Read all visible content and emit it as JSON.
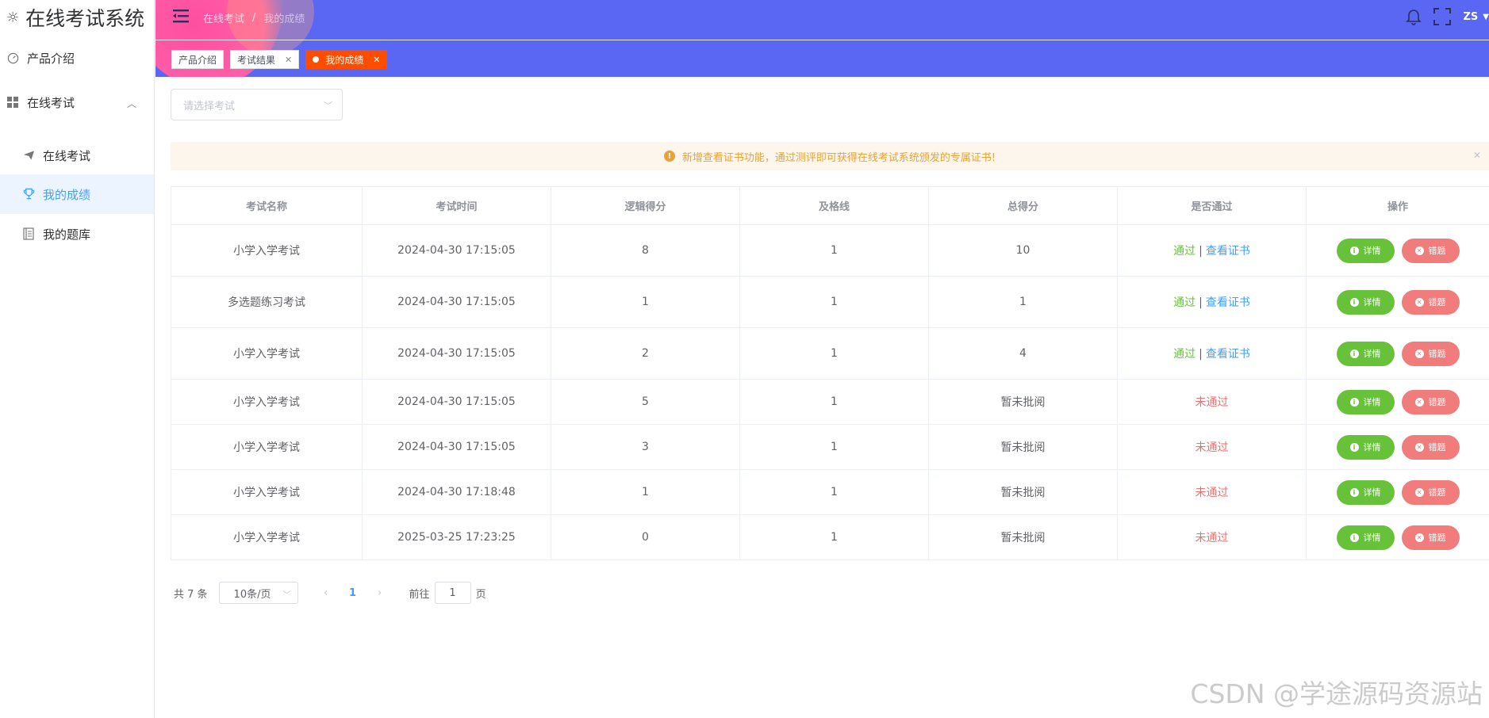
{
  "app": {
    "title": "在线考试系统",
    "logo_icon": "sun-icon"
  },
  "sidebar": {
    "items": [
      {
        "label": "产品介绍",
        "icon": "speedometer-icon"
      },
      {
        "label": "在线考试",
        "icon": "grid-icon",
        "expanded": true
      },
      {
        "label": "在线考试",
        "icon": "paper-plane-icon",
        "sub": true
      },
      {
        "label": "我的成绩",
        "icon": "trophy-icon",
        "sub": true,
        "active": true
      },
      {
        "label": "我的题库",
        "icon": "notebook-icon",
        "sub": true
      }
    ]
  },
  "header": {
    "breadcrumb": [
      "在线考试",
      "我的成绩"
    ],
    "breadcrumb_sep": "/",
    "user": "ZS",
    "icons": [
      "menu-fold-icon",
      "bell-icon",
      "fullscreen-icon"
    ]
  },
  "tags": [
    {
      "label": "产品介绍",
      "closable": false
    },
    {
      "label": "考试结果",
      "closable": true
    },
    {
      "label": "我的成绩",
      "closable": true,
      "active": true
    }
  ],
  "filter": {
    "placeholder": "请选择考试"
  },
  "alert": {
    "text": "新增查看证书功能，通过测评即可获得在线考试系统颁发的专属证书!"
  },
  "table": {
    "headers": [
      "考试名称",
      "考试时间",
      "逻辑得分",
      "及格线",
      "总得分",
      "是否通过",
      "操作"
    ],
    "rows": [
      {
        "name": "小学入学考试",
        "time": "2024-04-30 17:15:05",
        "logic": "8",
        "pass_line": "1",
        "total": "10",
        "passed": true
      },
      {
        "name": "多选题练习考试",
        "time": "2024-04-30 17:15:05",
        "logic": "1",
        "pass_line": "1",
        "total": "1",
        "passed": true
      },
      {
        "name": "小学入学考试",
        "time": "2024-04-30 17:15:05",
        "logic": "2",
        "pass_line": "1",
        "total": "4",
        "passed": true
      },
      {
        "name": "小学入学考试",
        "time": "2024-04-30 17:15:05",
        "logic": "5",
        "pass_line": "1",
        "total": "暂未批阅",
        "passed": false
      },
      {
        "name": "小学入学考试",
        "time": "2024-04-30 17:15:05",
        "logic": "3",
        "pass_line": "1",
        "total": "暂未批阅",
        "passed": false
      },
      {
        "name": "小学入学考试",
        "time": "2024-04-30 17:18:48",
        "logic": "1",
        "pass_line": "1",
        "total": "暂未批阅",
        "passed": false
      },
      {
        "name": "小学入学考试",
        "time": "2025-03-25 17:23:25",
        "logic": "0",
        "pass_line": "1",
        "total": "暂未批阅",
        "passed": false
      }
    ],
    "pass_label": "通过",
    "cert_label": "查看证书",
    "fail_label": "未通过",
    "detail_label": "详情",
    "wrong_label": "错题"
  },
  "pagination": {
    "total_text": "共 7 条",
    "page_size": "10条/页",
    "current_page": "1",
    "goto_prefix": "前往",
    "goto_value": "1",
    "goto_suffix": "页"
  },
  "watermark": "CSDN @学途源码资源站",
  "colors": {
    "header": "#5967f2",
    "accent": "#409eff",
    "pass": "#67c23a",
    "fail": "#f56c6c",
    "active_tag": "#ff4d00"
  }
}
